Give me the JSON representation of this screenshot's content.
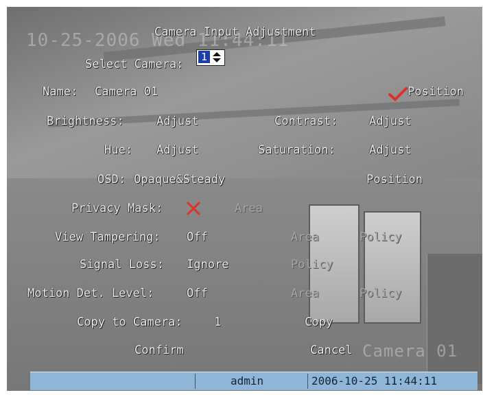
{
  "background": {
    "timestamp_watermark": "10-25-2006 Wed 11:44:11",
    "camera_watermark": "Camera 01"
  },
  "dialog": {
    "title": "Camera Input Adjustment",
    "select_camera_label": "Select Camera:",
    "select_camera_value": "1",
    "name_label": "Name:",
    "name_value": "Camera 01",
    "name_position_enabled": true,
    "name_position_label": "Position",
    "brightness_label": "Brightness:",
    "brightness_button": "Adjust",
    "contrast_label": "Contrast:",
    "contrast_button": "Adjust",
    "hue_label": "Hue:",
    "hue_button": "Adjust",
    "saturation_label": "Saturation:",
    "saturation_button": "Adjust",
    "osd_label": "OSD:",
    "osd_value": "Opaque&Steady",
    "osd_position_label": "Position",
    "privacy_mask_label": "Privacy Mask:",
    "privacy_mask_enabled": false,
    "privacy_mask_area": "Area",
    "view_tampering_label": "View Tampering:",
    "view_tampering_value": "Off",
    "view_tampering_area": "Area",
    "view_tampering_policy": "Policy",
    "signal_loss_label": "Signal Loss:",
    "signal_loss_value": "Ignore",
    "signal_loss_policy": "Policy",
    "motion_label": "Motion Det. Level:",
    "motion_value": "Off",
    "motion_area": "Area",
    "motion_policy": "Policy",
    "copy_to_label": "Copy to Camera:",
    "copy_to_value": "1",
    "copy_button": "Copy",
    "confirm_button": "Confirm",
    "cancel_button": "Cancel"
  },
  "status_bar": {
    "user": "admin",
    "datetime": "2006-10-25 11:44:11"
  },
  "colors": {
    "osd_text": "#ececec",
    "disabled_text": "#a6a6a6",
    "check_red": "#e0302c",
    "status_bar": "#8fb6d6",
    "spin_highlight": "#1e3da8"
  }
}
